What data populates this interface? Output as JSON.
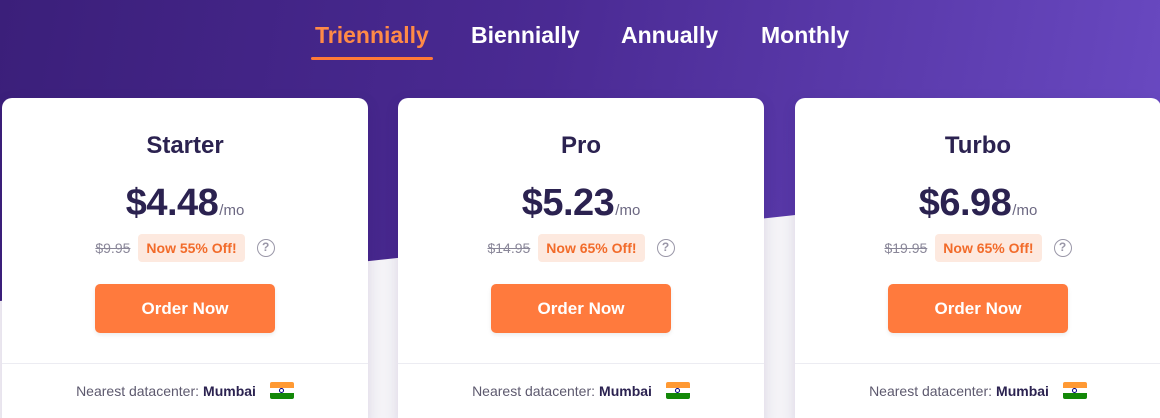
{
  "billing_tabs": [
    {
      "label": "Triennially",
      "active": true
    },
    {
      "label": "Biennially",
      "active": false
    },
    {
      "label": "Annually",
      "active": false
    },
    {
      "label": "Monthly",
      "active": false
    }
  ],
  "plans": [
    {
      "name": "Starter",
      "price": "$4.48",
      "period": "/mo",
      "old_price": "$9.95",
      "discount": "Now 55% Off!",
      "help_glyph": "?",
      "order_label": "Order Now",
      "datacenter_label": "Nearest datacenter:",
      "datacenter_city": "Mumbai",
      "flag_icon": "india-flag-icon"
    },
    {
      "name": "Pro",
      "price": "$5.23",
      "period": "/mo",
      "old_price": "$14.95",
      "discount": "Now 65% Off!",
      "help_glyph": "?",
      "order_label": "Order Now",
      "datacenter_label": "Nearest datacenter:",
      "datacenter_city": "Mumbai",
      "flag_icon": "india-flag-icon"
    },
    {
      "name": "Turbo",
      "price": "$6.98",
      "period": "/mo",
      "old_price": "$19.95",
      "discount": "Now 65% Off!",
      "help_glyph": "?",
      "order_label": "Order Now",
      "datacenter_label": "Nearest datacenter:",
      "datacenter_city": "Mumbai",
      "flag_icon": "india-flag-icon"
    }
  ],
  "colors": {
    "accent": "#ff7a3d",
    "hero_start": "#3b1f7a",
    "hero_end": "#6b4bc4",
    "heading": "#2b2250",
    "badge_bg": "#fde9df"
  }
}
